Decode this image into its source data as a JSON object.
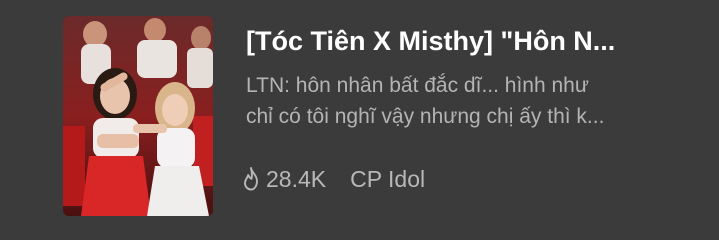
{
  "card": {
    "title": "[Tóc Tiên X Misthy] \"Hôn N...",
    "description_lines": [
      "LTN: hôn nhân bất đắc dĩ... hình như",
      "chỉ có tôi nghĩ vậy nhưng chị ấy thì k..."
    ],
    "views": "28.4K",
    "category": "CP Idol",
    "views_icon": "flame-icon",
    "thumbnail_icon": "cover-image"
  }
}
